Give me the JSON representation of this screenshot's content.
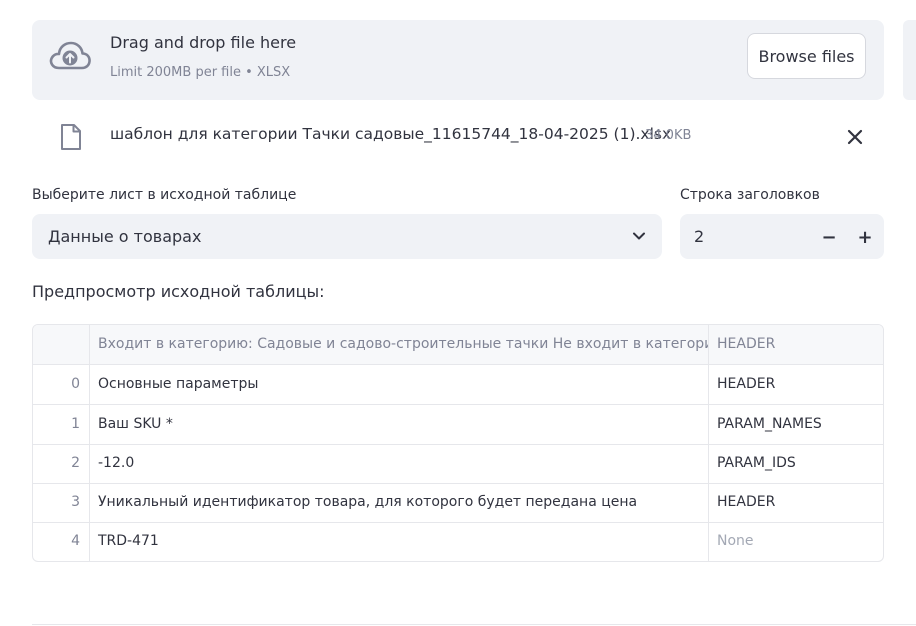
{
  "uploader": {
    "title": "Drag and drop file here",
    "subtitle": "Limit 200MB per file • XLSX",
    "browse_label": "Browse files"
  },
  "uploaded_file": {
    "name": "шаблон для категории Тачки садовые_11615744_18-04-2025 (1).xlsx",
    "size": "34.0KB"
  },
  "sheet_select": {
    "label": "Выберите лист в исходной таблице",
    "value": "Данные о товарах"
  },
  "header_row": {
    "label": "Строка заголовков",
    "value": "2",
    "minus_label": "−",
    "plus_label": "+"
  },
  "preview": {
    "heading": "Предпросмотр исходной таблицы:"
  },
  "table": {
    "columns": [
      "",
      "Входит в категорию: Садовые и садово-строительные тачки  Не входит в категорию: - тележки",
      "HEADER"
    ],
    "rows": [
      [
        "0",
        "Основные параметры",
        "HEADER"
      ],
      [
        "1",
        "Ваш SKU *",
        "PARAM_NAMES"
      ],
      [
        "2",
        "-12.0",
        "PARAM_IDS"
      ],
      [
        "3",
        "Уникальный идентификатор товара, для которого будет передана цена",
        "HEADER"
      ],
      [
        "4",
        "TRD-471",
        "None"
      ]
    ]
  },
  "icons": {
    "upload": "cloud-upload-icon",
    "file": "file-icon",
    "close": "close-icon",
    "chevron": "chevron-down-icon"
  },
  "colors": {
    "surface": "#f0f2f6",
    "text": "#31333f",
    "muted": "#808495",
    "border": "#e6e7eb"
  }
}
